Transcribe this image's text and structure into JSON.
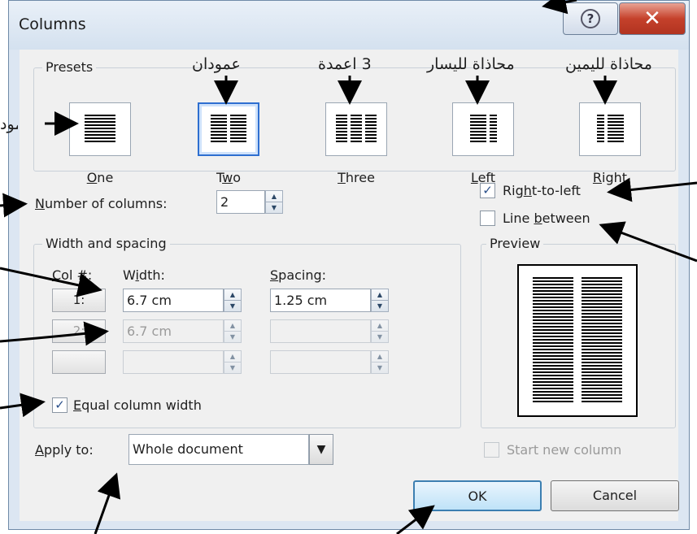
{
  "window": {
    "title": "Columns",
    "help_icon": "question-icon",
    "close_icon": "close-icon"
  },
  "presets": {
    "label": "Presets",
    "items": [
      {
        "label": "One",
        "key": "O"
      },
      {
        "label": "Two",
        "key": "w"
      },
      {
        "label": "Three",
        "key": "T"
      },
      {
        "label": "Left",
        "key": "L"
      },
      {
        "label": "Right",
        "key": "R"
      }
    ]
  },
  "number_of_columns": {
    "label": "Number of columns:",
    "value": "2"
  },
  "right_to_left": {
    "label": "Right-to-left",
    "checked": true
  },
  "line_between": {
    "label": "Line between",
    "checked": false
  },
  "width_spacing": {
    "label": "Width and spacing",
    "col_header": "Col #:",
    "width_header": "Width:",
    "spacing_header": "Spacing:",
    "rows": [
      {
        "col": "1:",
        "width": "6.7 cm",
        "spacing": "1.25 cm"
      },
      {
        "col": "2:",
        "width": "6.7 cm",
        "spacing": ""
      },
      {
        "col": "",
        "width": "",
        "spacing": ""
      }
    ]
  },
  "equal_width": {
    "label": "Equal column width",
    "checked": true
  },
  "preview": {
    "label": "Preview"
  },
  "apply_to": {
    "label": "Apply to:",
    "value": "Whole document"
  },
  "start_new_column": {
    "label": "Start new column",
    "checked": false
  },
  "buttons": {
    "ok": "OK",
    "cancel": "Cancel"
  },
  "annotations": {
    "two": "عمودان",
    "three": "3 اعمدة",
    "left": "محاذاة لليسار",
    "right": "محاذاة لليمين",
    "one": "عمود"
  }
}
